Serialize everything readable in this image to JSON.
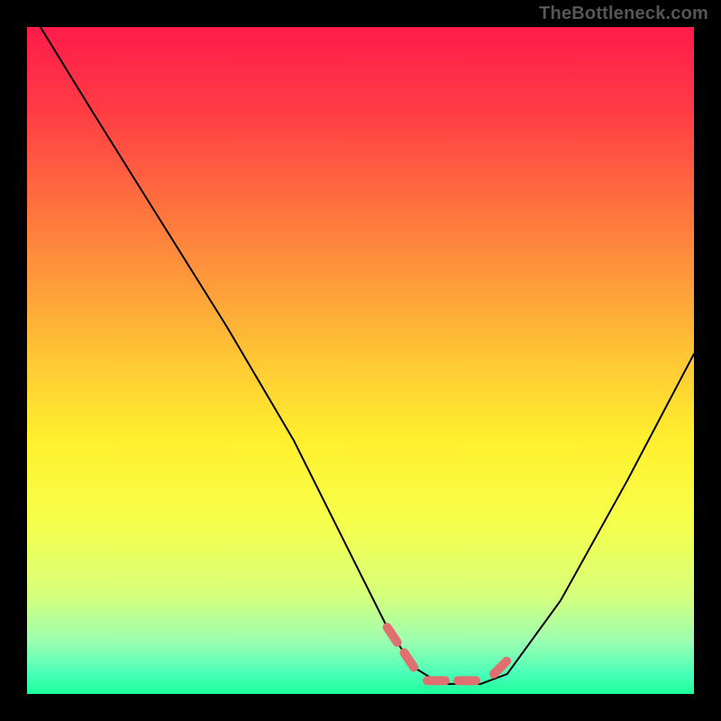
{
  "watermark": "TheBottleneck.com",
  "colors": {
    "background": "#000000",
    "curve_stroke": "#000000",
    "accent_stroke": "#e07070",
    "gradient_stops": [
      {
        "offset": 0.0,
        "color": "#ff1b4b"
      },
      {
        "offset": 0.12,
        "color": "#ff3a45"
      },
      {
        "offset": 0.25,
        "color": "#ff6a3f"
      },
      {
        "offset": 0.38,
        "color": "#ff9a3a"
      },
      {
        "offset": 0.5,
        "color": "#ffc834"
      },
      {
        "offset": 0.62,
        "color": "#fff02e"
      },
      {
        "offset": 0.74,
        "color": "#f6ff4a"
      },
      {
        "offset": 0.85,
        "color": "#d7ff7a"
      },
      {
        "offset": 0.92,
        "color": "#9dffb0"
      },
      {
        "offset": 0.97,
        "color": "#49ffb8"
      },
      {
        "offset": 1.0,
        "color": "#1bff9a"
      }
    ]
  },
  "chart_data": {
    "type": "line",
    "title": "",
    "xlabel": "",
    "ylabel": "",
    "xlim": [
      0,
      100
    ],
    "ylim": [
      0,
      100
    ],
    "grid": false,
    "series": [
      {
        "name": "curve",
        "x": [
          2,
          10,
          20,
          30,
          40,
          48,
          54,
          58,
          62,
          68,
          72,
          80,
          90,
          100
        ],
        "y": [
          100,
          87,
          71,
          55,
          38,
          22,
          10,
          4,
          1.5,
          1.5,
          3,
          14,
          32,
          51
        ]
      }
    ],
    "accent_segments": [
      {
        "x": [
          54,
          58
        ],
        "y": [
          10,
          4
        ]
      },
      {
        "x": [
          60,
          68
        ],
        "y": [
          2,
          2
        ]
      },
      {
        "x": [
          70,
          73
        ],
        "y": [
          3,
          6
        ]
      }
    ]
  }
}
